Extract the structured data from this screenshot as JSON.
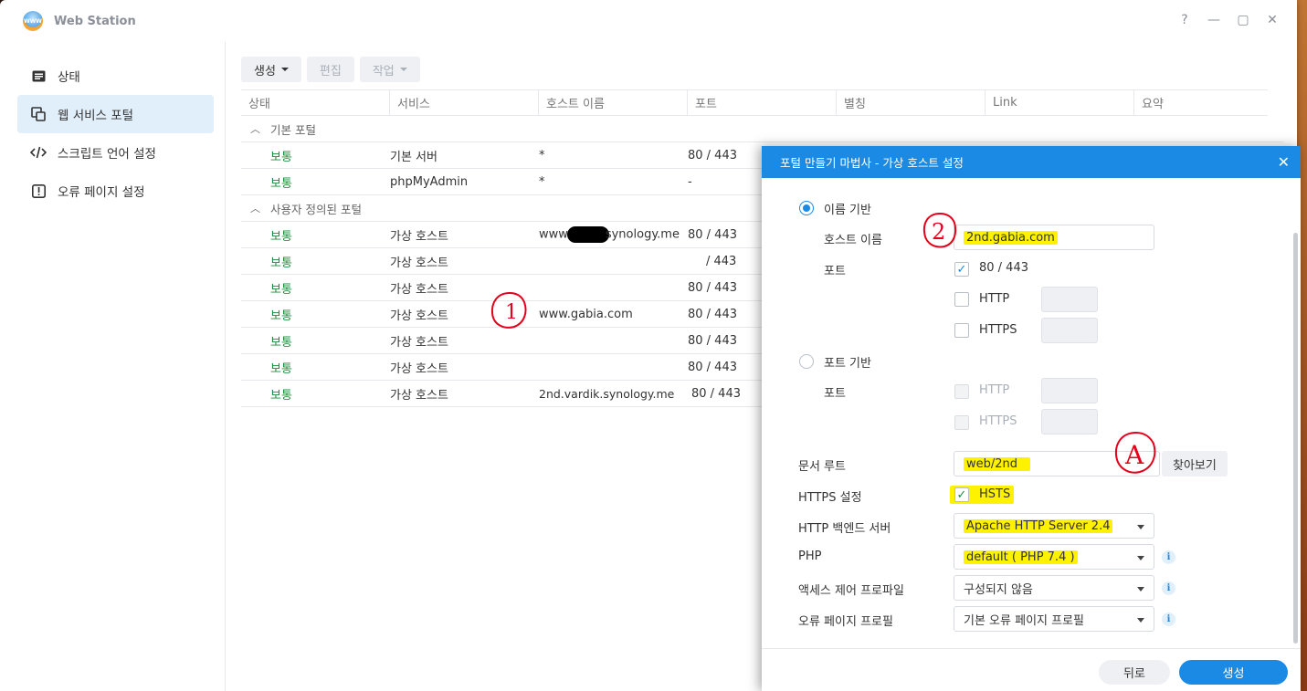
{
  "window": {
    "title": "Web Station",
    "controls": [
      "?",
      "—",
      "▢",
      "✕"
    ]
  },
  "sidebar": {
    "items": [
      {
        "label": "상태",
        "icon": "status-icon"
      },
      {
        "label": "웹 서비스 포털",
        "icon": "portal-icon",
        "active": true
      },
      {
        "label": "스크립트 언어 설정",
        "icon": "code-icon"
      },
      {
        "label": "오류 페이지 설정",
        "icon": "error-icon"
      }
    ]
  },
  "toolbar": {
    "create": "생성",
    "edit": "편집",
    "action": "작업"
  },
  "table": {
    "columns": [
      "상태",
      "서비스",
      "호스트 이름",
      "포트",
      "별칭",
      "Link",
      "요약"
    ],
    "groups": [
      {
        "label": "기본 포털",
        "rows": [
          {
            "status": "보통",
            "service": "기본 서버",
            "host": "*",
            "port": "80 / 443"
          },
          {
            "status": "보통",
            "service": "phpMyAdmin",
            "host": "*",
            "port": "-"
          }
        ]
      },
      {
        "label": "사용자 정의된 포털",
        "rows": [
          {
            "status": "보통",
            "service": "가상 호스트",
            "host_prefix": "www.",
            "host": "synology.me",
            "port": "80 / 443",
            "redacted": true
          },
          {
            "status": "보통",
            "service": "가상 호스트",
            "host": "",
            "port": "/ 443"
          },
          {
            "status": "보통",
            "service": "가상 호스트",
            "host": "",
            "port": "80 / 443"
          },
          {
            "status": "보통",
            "service": "가상 호스트",
            "host": "www.gabia.com",
            "port": "80 / 443"
          },
          {
            "status": "보통",
            "service": "가상 호스트",
            "host": "",
            "port": "80 / 443"
          },
          {
            "status": "보통",
            "service": "가상 호스트",
            "host": "",
            "port": "80 / 443"
          },
          {
            "status": "보통",
            "service": "가상 호스트",
            "host": "2nd.vardik.synology.me",
            "port": "80 / 443"
          }
        ]
      }
    ]
  },
  "annotations": {
    "one": "1",
    "two": "2",
    "a": "A"
  },
  "dialog": {
    "title": "포털 만들기 마법사 - 가상 호스트 설정",
    "name_based": "이름 기반",
    "hostname_label": "호스트 이름",
    "hostname_value": "2nd.gabia.com",
    "port_label": "포트",
    "port_default": "80 / 443",
    "http": "HTTP",
    "https": "HTTPS",
    "port_based": "포트 기반",
    "doc_root_label": "문서 루트",
    "doc_root_value": "web/2nd",
    "browse": "찾아보기",
    "https_settings_label": "HTTPS 설정",
    "hsts": "HSTS",
    "backend_label": "HTTP 백엔드 서버",
    "backend_value": "Apache HTTP Server 2.4",
    "php_label": "PHP",
    "php_value": "default ( PHP 7.4 )",
    "access_label": "액세스 제어 프로파일",
    "access_value": "구성되지 않음",
    "error_label": "오류 페이지 프로필",
    "error_value": "기본 오류 페이지 프로필",
    "back": "뒤로",
    "create": "생성"
  }
}
